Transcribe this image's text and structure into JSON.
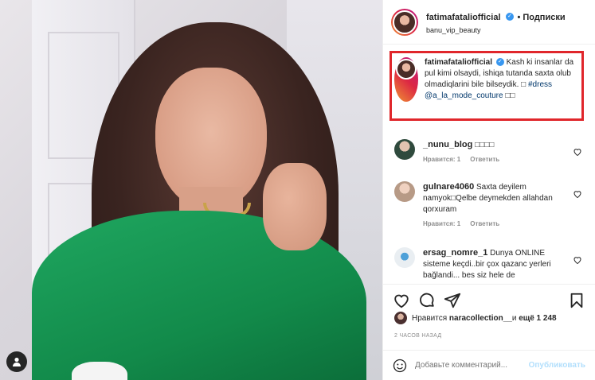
{
  "post": {
    "author": "fatimafataliofficial",
    "follow_label": "• Подписки",
    "location": "banu_vip_beauty"
  },
  "caption": {
    "author": "fatimafataliofficial",
    "text": "Kash ki insanlar da pul kimi olsaydi, ishiqa tutanda saxta olub olmadiqlarini bile bilseydik. □ ",
    "hashtag": "#dress",
    "mention": "@a_la_mode_couture",
    "trail": " □□"
  },
  "comments": [
    {
      "user": "_nunu_blog",
      "text": "□□□□",
      "likes": "Нравится: 1",
      "reply": "Ответить"
    },
    {
      "user": "gulnare4060",
      "text": "Saxta deyilem namyok□Qelbe deymekden allahdan qorxuram",
      "likes": "Нравится: 1",
      "reply": "Ответить"
    },
    {
      "user": "ersag_nomre_1",
      "text": "Dunya ONLINE sisteme keçdi..bir çox qazanc yerleri bağlandi... bes siz hele de",
      "likes": "",
      "reply": ""
    }
  ],
  "likes": {
    "prefix": "Нравится ",
    "user": "naracollection__",
    "middle": " и ",
    "count": "ещё 1 248"
  },
  "timestamp": "2 ЧАСОВ НАЗАД",
  "add_comment": {
    "placeholder": "Добавьте комментарий...",
    "publish": "Опубликовать"
  },
  "icons": [
    "user-tag-icon",
    "verified-icon",
    "heart-icon",
    "comment-icon",
    "share-icon",
    "bookmark-icon",
    "emoji-icon"
  ]
}
